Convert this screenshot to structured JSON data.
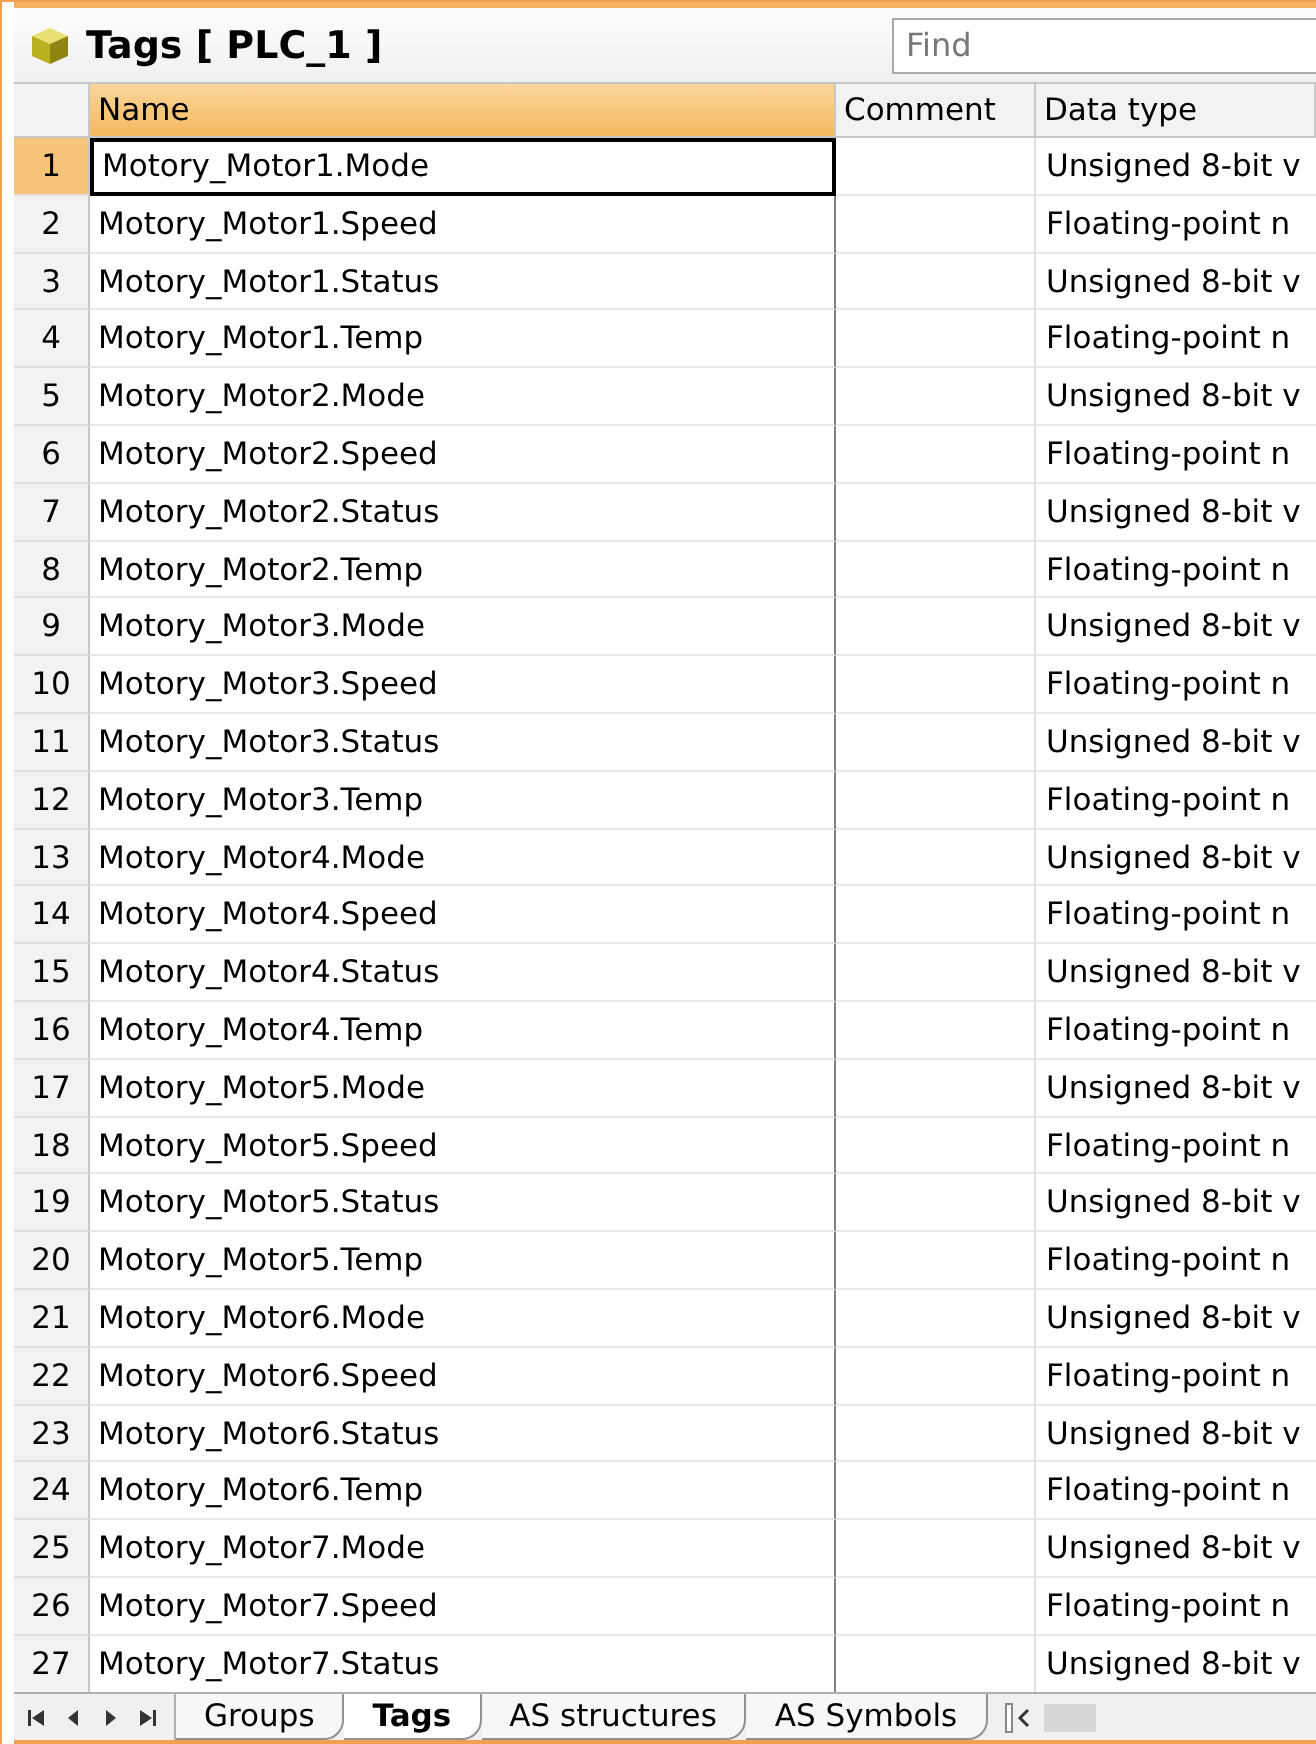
{
  "title": "Tags [ PLC_1 ]",
  "search": {
    "placeholder": "Find"
  },
  "columns": [
    {
      "label": "Name",
      "selected": true
    },
    {
      "label": "Comment",
      "selected": false
    },
    {
      "label": "Data type",
      "selected": false
    }
  ],
  "rows": [
    {
      "number": "1",
      "name": "Motory_Motor1.Mode",
      "data_type": "Unsigned 8-bit v",
      "selected": true
    },
    {
      "number": "2",
      "name": "Motory_Motor1.Speed",
      "data_type": "Floating-point n",
      "selected": false
    },
    {
      "number": "3",
      "name": "Motory_Motor1.Status",
      "data_type": "Unsigned 8-bit v",
      "selected": false
    },
    {
      "number": "4",
      "name": "Motory_Motor1.Temp",
      "data_type": "Floating-point n",
      "selected": false
    },
    {
      "number": "5",
      "name": "Motory_Motor2.Mode",
      "data_type": "Unsigned 8-bit v",
      "selected": false
    },
    {
      "number": "6",
      "name": "Motory_Motor2.Speed",
      "data_type": "Floating-point n",
      "selected": false
    },
    {
      "number": "7",
      "name": "Motory_Motor2.Status",
      "data_type": "Unsigned 8-bit v",
      "selected": false
    },
    {
      "number": "8",
      "name": "Motory_Motor2.Temp",
      "data_type": "Floating-point n",
      "selected": false
    },
    {
      "number": "9",
      "name": "Motory_Motor3.Mode",
      "data_type": "Unsigned 8-bit v",
      "selected": false
    },
    {
      "number": "10",
      "name": "Motory_Motor3.Speed",
      "data_type": "Floating-point n",
      "selected": false
    },
    {
      "number": "11",
      "name": "Motory_Motor3.Status",
      "data_type": "Unsigned 8-bit v",
      "selected": false
    },
    {
      "number": "12",
      "name": "Motory_Motor3.Temp",
      "data_type": "Floating-point n",
      "selected": false
    },
    {
      "number": "13",
      "name": "Motory_Motor4.Mode",
      "data_type": "Unsigned 8-bit v",
      "selected": false
    },
    {
      "number": "14",
      "name": "Motory_Motor4.Speed",
      "data_type": "Floating-point n",
      "selected": false
    },
    {
      "number": "15",
      "name": "Motory_Motor4.Status",
      "data_type": "Unsigned 8-bit v",
      "selected": false
    },
    {
      "number": "16",
      "name": "Motory_Motor4.Temp",
      "data_type": "Floating-point n",
      "selected": false
    },
    {
      "number": "17",
      "name": "Motory_Motor5.Mode",
      "data_type": "Unsigned 8-bit v",
      "selected": false
    },
    {
      "number": "18",
      "name": "Motory_Motor5.Speed",
      "data_type": "Floating-point n",
      "selected": false
    },
    {
      "number": "19",
      "name": "Motory_Motor5.Status",
      "data_type": "Unsigned 8-bit v",
      "selected": false
    },
    {
      "number": "20",
      "name": "Motory_Motor5.Temp",
      "data_type": "Floating-point n",
      "selected": false
    },
    {
      "number": "21",
      "name": "Motory_Motor6.Mode",
      "data_type": "Unsigned 8-bit v",
      "selected": false
    },
    {
      "number": "22",
      "name": "Motory_Motor6.Speed",
      "data_type": "Floating-point n",
      "selected": false
    },
    {
      "number": "23",
      "name": "Motory_Motor6.Status",
      "data_type": "Unsigned 8-bit v",
      "selected": false
    },
    {
      "number": "24",
      "name": "Motory_Motor6.Temp",
      "data_type": "Floating-point n",
      "selected": false
    },
    {
      "number": "25",
      "name": "Motory_Motor7.Mode",
      "data_type": "Unsigned 8-bit v",
      "selected": false
    },
    {
      "number": "26",
      "name": "Motory_Motor7.Speed",
      "data_type": "Floating-point n",
      "selected": false
    },
    {
      "number": "27",
      "name": "Motory_Motor7.Status",
      "data_type": "Unsigned 8-bit v",
      "selected": false
    }
  ],
  "sheet_tabs": [
    {
      "label": "Groups",
      "selected": false
    },
    {
      "label": "Tags",
      "selected": true
    },
    {
      "label": "AS structures",
      "selected": false
    },
    {
      "label": "AS Symbols",
      "selected": false
    }
  ]
}
